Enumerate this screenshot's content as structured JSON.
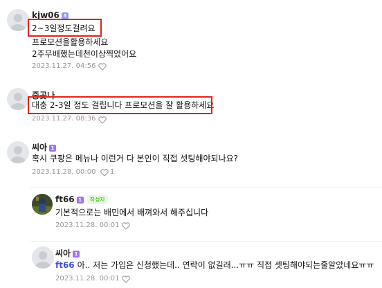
{
  "comments": [
    {
      "author": "kjw06",
      "badge": "3",
      "lines": [
        "2~3일정도걸려요",
        "프로모션을활용하세요",
        "2주무배했는데천이상찍었어요"
      ],
      "date": "2023.11.27. 04:56"
    },
    {
      "author": "중곳나",
      "lines": [
        "대충 2-3일 정도 걸립니다 프로모션을 잘 활용하세요"
      ],
      "date": "2023.11.27. 08:36"
    },
    {
      "author": "씨아",
      "badge": "1",
      "lines": [
        "혹시 쿠팡은 메뉴나 이런거 다 본인이 직접 셋팅해야되나요?"
      ],
      "date": "2023.11.28. 00:00",
      "likes": "1"
    }
  ],
  "replies": [
    {
      "author": "ft66",
      "badge": "1",
      "writer_tag": "작성자",
      "text": "기본적으로는 배민에서 배껴와서 해주십니다",
      "date": "2023.11.28. 00:01"
    },
    {
      "author": "씨아",
      "badge": "1",
      "mention": "ft66",
      "text": "아.. 저는 가입은 신청했는데.. 연락이 없길래...ㅠㅠ 직접 셋팅해야되는줄알았네요ㅠㅠ",
      "date": "2023.11.28. 00:01"
    }
  ],
  "colors": {
    "highlight": "#e0231c",
    "badge_blue": "#8c9bf5",
    "badge_purple": "#a671f0",
    "mention": "#3b4fd1",
    "meta": "#979797"
  },
  "icons": [
    "default-avatar-icon",
    "heart-icon",
    "user-photo-avatar"
  ]
}
